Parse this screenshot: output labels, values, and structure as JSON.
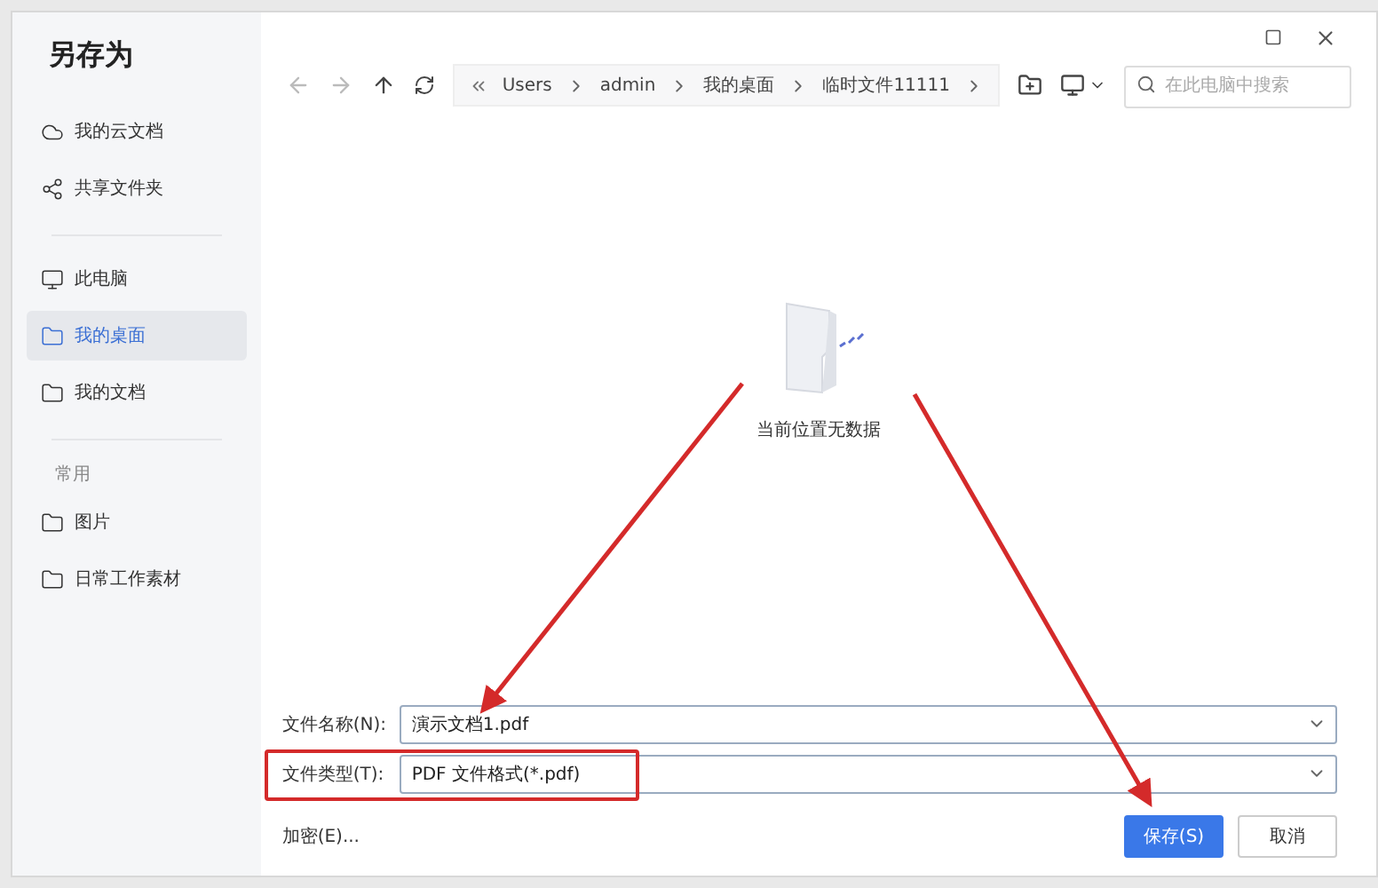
{
  "window": {
    "title": "另存为"
  },
  "sidebar": {
    "groups": [
      {
        "items": [
          {
            "label": "我的云文档",
            "selected": false
          },
          {
            "label": "共享文件夹",
            "selected": false
          }
        ]
      },
      {
        "items": [
          {
            "label": "此电脑",
            "selected": false
          },
          {
            "label": "我的桌面",
            "selected": true
          },
          {
            "label": "我的文档",
            "selected": false
          }
        ]
      },
      {
        "heading": "常用",
        "items": [
          {
            "label": "图片",
            "selected": false
          },
          {
            "label": "日常工作素材",
            "selected": false
          }
        ]
      }
    ]
  },
  "breadcrumb": [
    "Users",
    "admin",
    "我的桌面",
    "临时文件11111"
  ],
  "search": {
    "placeholder": "在此电脑中搜索"
  },
  "empty_state": {
    "message": "当前位置无数据"
  },
  "fields": [
    {
      "label": "文件名称(N):",
      "value": "演示文档1.pdf",
      "highlighted": false
    },
    {
      "label": "文件类型(T):",
      "value": "PDF 文件格式(*.pdf)",
      "highlighted": true
    }
  ],
  "encrypt_link": "加密(E)...",
  "buttons": [
    {
      "label": "保存(S)",
      "kind": "primary"
    },
    {
      "label": "取消",
      "kind": "secondary"
    }
  ]
}
